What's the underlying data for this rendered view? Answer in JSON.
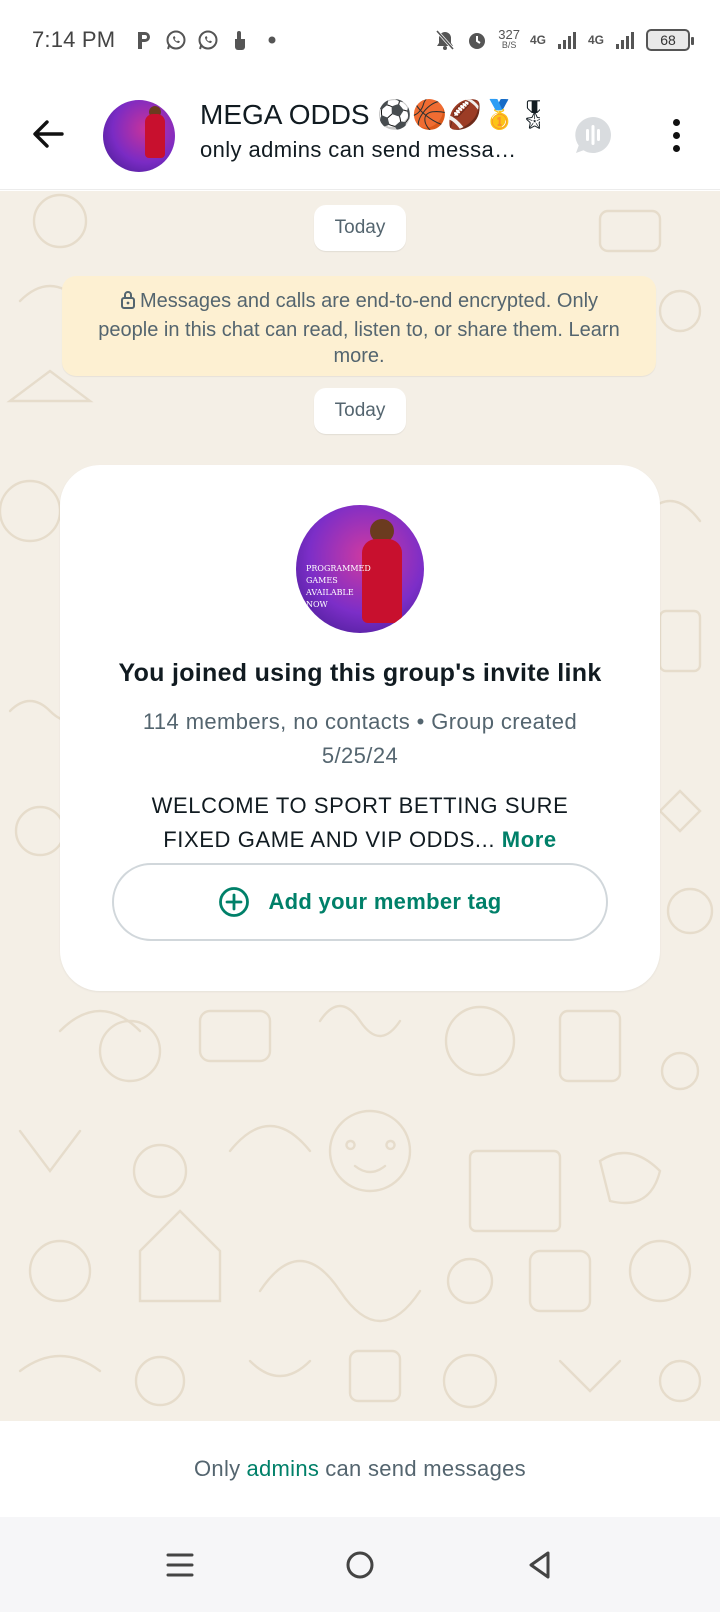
{
  "status_bar": {
    "time": "7:14 PM",
    "net_speed_value": "327",
    "net_speed_unit": "B/S",
    "sim1_label": "4G",
    "sim2_label": "4G",
    "battery": "68",
    "left_icons": [
      "parking-icon",
      "whatsapp-icon",
      "whatsapp-icon",
      "touch-icon",
      "dot-icon"
    ],
    "right_icons": [
      "bell-off-icon",
      "alarm-icon",
      "signal-icon",
      "signal-icon"
    ]
  },
  "header": {
    "title": "MEGA ODDS ⚽🏀🏈🥇🎖",
    "subtitle": "only admins can send messa…",
    "icons": [
      "back-arrow-icon",
      "voice-chat-icon",
      "more-vert-icon"
    ]
  },
  "chat": {
    "date_chip_1": "Today",
    "encryption_text": "Messages and calls are end-to-end encrypted. Only people in this chat can read, listen to, or share them. Learn more.",
    "date_chip_2": "Today",
    "card": {
      "avatar_text": "PROGRAMMED GAMES AVAILABLE NOW",
      "title": "You joined using this group's invite link",
      "meta": "114 members, no contacts • Group created 5/25/24",
      "description": "WELCOME TO SPORT BETTING SURE FIXED GAME AND VIP ODDS...",
      "more_label": "More",
      "member_tag_label": "Add your member tag"
    }
  },
  "footer": {
    "prefix": "Only",
    "admins": "admins",
    "suffix": "can send messages"
  },
  "nav": {
    "icons": [
      "recents-icon",
      "home-icon",
      "back-icon"
    ]
  },
  "colors": {
    "accent": "#008069",
    "chat_bg": "#f4efe6",
    "encryption_bg": "#fdf0d2",
    "secondary_text": "#54656f"
  }
}
